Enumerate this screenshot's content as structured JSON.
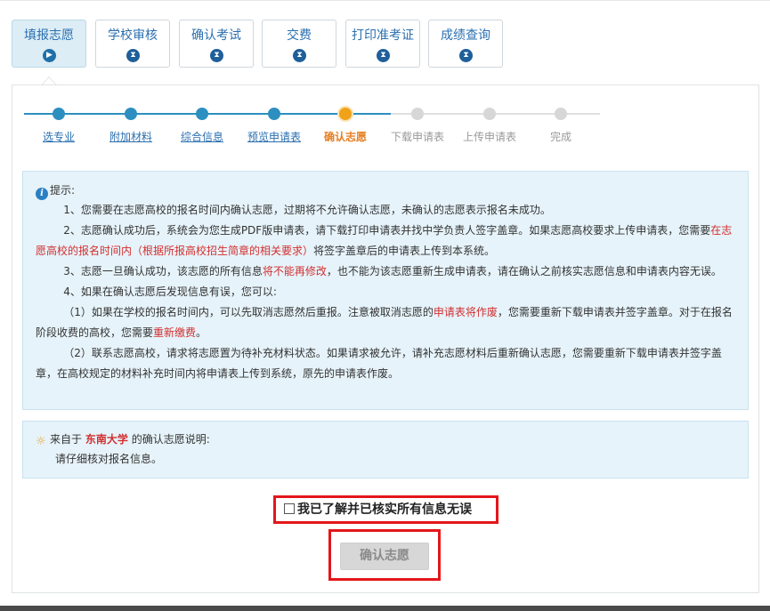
{
  "tabs": [
    {
      "label": "填报志愿",
      "icon": "play-icon",
      "glyph": "▶",
      "active": true
    },
    {
      "label": "学校审核",
      "icon": "hourglass-icon",
      "glyph": "⧗",
      "active": false
    },
    {
      "label": "确认考试",
      "icon": "hourglass-icon",
      "glyph": "⧗",
      "active": false
    },
    {
      "label": "交费",
      "icon": "hourglass-icon",
      "glyph": "⧗",
      "active": false
    },
    {
      "label": "打印准考证",
      "icon": "hourglass-icon",
      "glyph": "⧗",
      "active": false
    },
    {
      "label": "成绩查询",
      "icon": "hourglass-icon",
      "glyph": "⧗",
      "active": false
    }
  ],
  "steps": [
    {
      "label": "选专业",
      "state": "done"
    },
    {
      "label": "附加材料",
      "state": "done"
    },
    {
      "label": "综合信息",
      "state": "done"
    },
    {
      "label": "预览申请表",
      "state": "done"
    },
    {
      "label": "确认志愿",
      "state": "current"
    },
    {
      "label": "下载申请表",
      "state": "todo"
    },
    {
      "label": "上传申请表",
      "state": "todo"
    },
    {
      "label": "完成",
      "state": "todo"
    }
  ],
  "notice": {
    "title": "提示:",
    "p1": "1、您需要在志愿高校的报名时间内确认志愿，过期将不允许确认志愿，未确认的志愿表示报名未成功。",
    "p2_a": "2、志愿确认成功后，系统会为您生成PDF版申请表，请下载打印申请表并找中学负责人签字盖章。如果志愿高校要求上传申请表，您需要",
    "p2_red": "在志愿高校的报名时间内（根据所报高校招生简章的相关要求）",
    "p2_b": "将签字盖章后的申请表上传到本系统。",
    "p3_a": "3、志愿一旦确认成功，该志愿的所有信息",
    "p3_red": "将不能再修改",
    "p3_b": "，也不能为该志愿重新生成申请表，请在确认之前核实志愿信息和申请表内容无误。",
    "p4": "4、如果在确认志愿后发现信息有误，您可以:",
    "p5_a": "（1）如果在学校的报名时间内，可以先取消志愿然后重报。注意被取消志愿的",
    "p5_red": "申请表将作废",
    "p5_b": "，您需要重新下载申请表并签字盖章。对于在报名阶段收费的高校，您需要",
    "p5_red2": "重新缴费",
    "p5_c": "。",
    "p6": "（2）联系志愿高校，请求将志愿置为待补充材料状态。如果请求被允许，请补充志愿材料后重新确认志愿，您需要重新下载申请表并签字盖章，在高校规定的材料补充时间内将申请表上传到系统，原先的申请表作废。"
  },
  "source": {
    "prefix": "来自于",
    "school": "东南大学",
    "suffix": "的确认志愿说明:",
    "desc": "请仔细核对报名信息。"
  },
  "agree": {
    "label": "我已了解并已核实所有信息无误",
    "checked": false
  },
  "confirm": {
    "label": "确认志愿",
    "enabled": false
  },
  "colors": {
    "accent": "#2a6fb0",
    "current_step": "#f0a31a",
    "warning_red": "#d32f2f",
    "highlight_border": "#e4161b"
  }
}
